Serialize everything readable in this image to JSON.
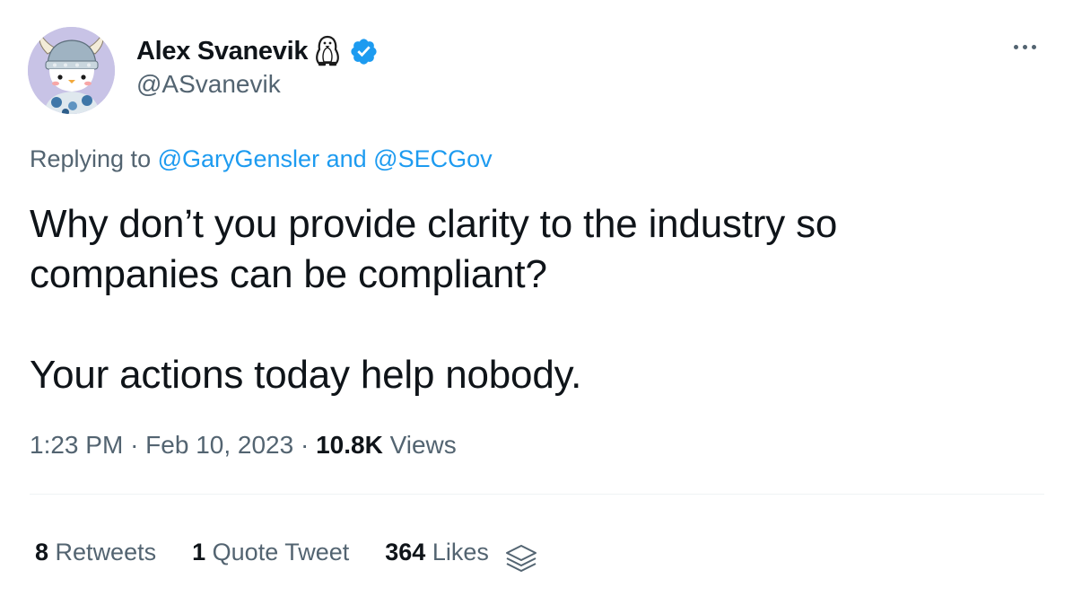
{
  "author": {
    "display_name": "Alex Svanevik",
    "emoji": "penguin-icon",
    "verified": true,
    "handle": "@ASvanevik"
  },
  "reply": {
    "prefix": "Replying to",
    "mention_1": "@GaryGensler",
    "conjunction": "and",
    "mention_2": "@SECGov"
  },
  "body": {
    "paragraph_1": "Why don’t you provide clarity to the industry so companies can be compliant?",
    "paragraph_2": "Your actions today help nobody."
  },
  "meta": {
    "time": "1:23 PM",
    "separator": "·",
    "date": "Feb 10, 2023",
    "views_count": "10.8K",
    "views_label": "Views"
  },
  "stats": {
    "retweets_count": "8",
    "retweets_label": "Retweets",
    "quotes_count": "1",
    "quotes_label": "Quote Tweet",
    "likes_count": "364",
    "likes_label": "Likes"
  },
  "colors": {
    "accent": "#1d9bf0",
    "text_primary": "#0f1419",
    "text_secondary": "#536471",
    "divider": "#eff3f4",
    "avatar_bg": "#c8c3e6"
  }
}
